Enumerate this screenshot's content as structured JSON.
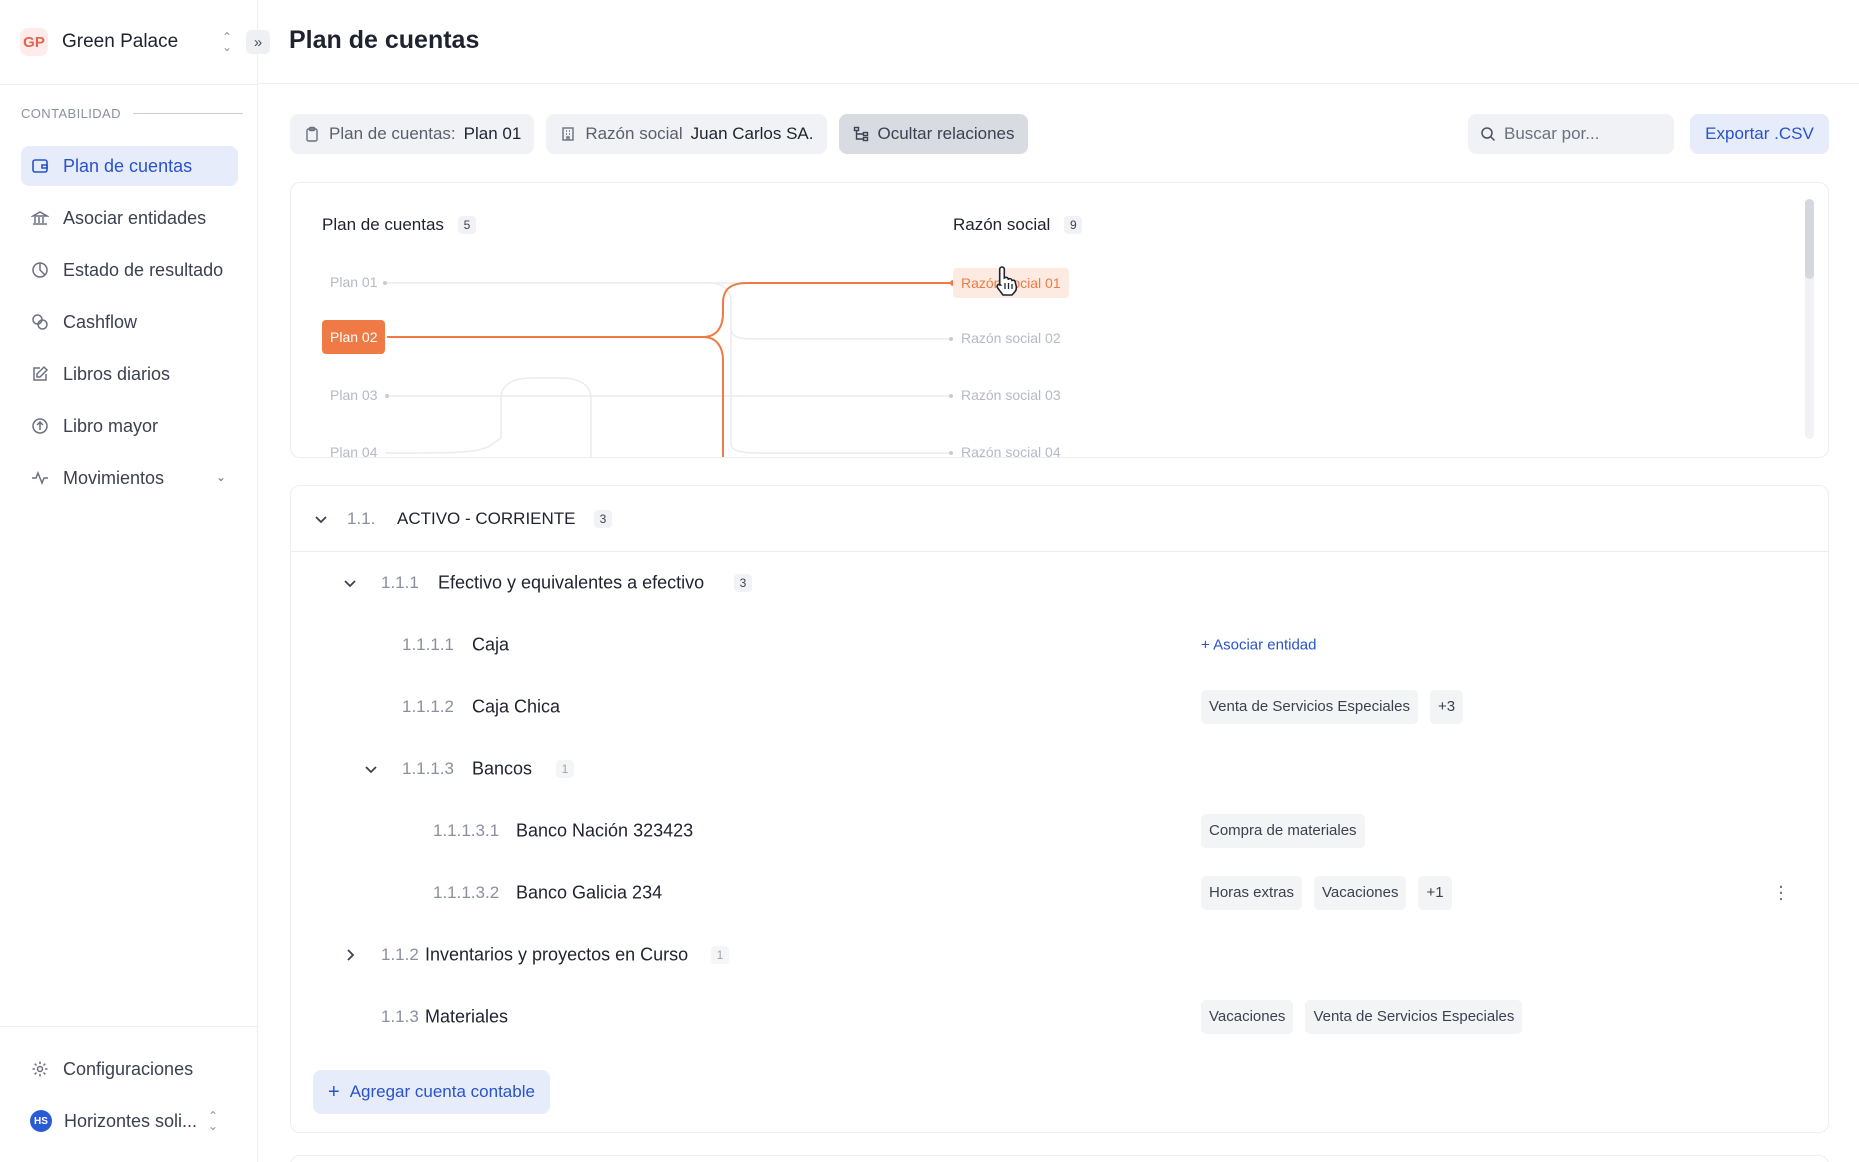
{
  "org": {
    "initials": "GP",
    "name": "Green Palace"
  },
  "header": {
    "title": "Plan de cuentas"
  },
  "sidebar": {
    "section": "CONTABILIDAD",
    "items": [
      {
        "label": "Plan de cuentas",
        "icon": "wallet-icon",
        "active": true
      },
      {
        "label": "Asociar entidades",
        "icon": "bank-icon"
      },
      {
        "label": "Estado de resultado",
        "icon": "pie-chart-icon"
      },
      {
        "label": "Cashflow",
        "icon": "coins-icon"
      },
      {
        "label": "Libros diarios",
        "icon": "edit-icon"
      },
      {
        "label": "Libro mayor",
        "icon": "arrow-up-circle-icon"
      },
      {
        "label": "Movimientos",
        "icon": "activity-icon"
      }
    ],
    "settings_label": "Configuraciones",
    "user": {
      "initials": "HS",
      "name": "Horizontes soli..."
    }
  },
  "filters": {
    "plan_label": "Plan de cuentas:",
    "plan_value": "Plan 01",
    "rs_label": "Razón social",
    "rs_value": "Juan Carlos SA.",
    "toggle_label": "Ocultar relaciones"
  },
  "search": {
    "placeholder": "Buscar por..."
  },
  "export_label": "Exportar .CSV",
  "relations": {
    "left_title": "Plan de cuentas",
    "left_count": "5",
    "right_title": "Razón social",
    "right_count": "9",
    "plans": [
      "Plan 01",
      "Plan 02",
      "Plan 03",
      "Plan 04"
    ],
    "razones": [
      "Razón social 01",
      "Razón social 02",
      "Razón social 03",
      "Razón social 04"
    ],
    "accent": "#f07a45"
  },
  "tree": {
    "group": {
      "code": "1.1.",
      "name": "ACTIVO  -  CORRIENTE",
      "count": "3"
    },
    "rows": [
      {
        "code": "1.1.1",
        "name": "Efectivo y equivalentes a efectivo",
        "count": "3"
      },
      {
        "code": "1.1.1.1",
        "name": "Caja",
        "action": "+  Asociar entidad"
      },
      {
        "code": "1.1.1.2",
        "name": "Caja Chica",
        "tags": [
          "Venta de Servicios Especiales",
          "+3"
        ]
      },
      {
        "code": "1.1.1.3",
        "name": "Bancos",
        "count": "1"
      },
      {
        "code": "1.1.1.3.1",
        "name": "Banco Nación 323423",
        "tags": [
          "Compra de materiales"
        ]
      },
      {
        "code": "1.1.1.3.2",
        "name": "Banco Galicia 234",
        "tags": [
          "Horas extras",
          "Vacaciones",
          "+1"
        ]
      },
      {
        "code": "1.1.2",
        "name": "Inventarios y proyectos en Curso",
        "count": "1"
      },
      {
        "code": "1.1.3",
        "name": "Materiales",
        "tags": [
          "Vacaciones",
          "Venta de Servicios Especiales"
        ]
      }
    ],
    "add_label": "Agregar cuenta contable"
  }
}
